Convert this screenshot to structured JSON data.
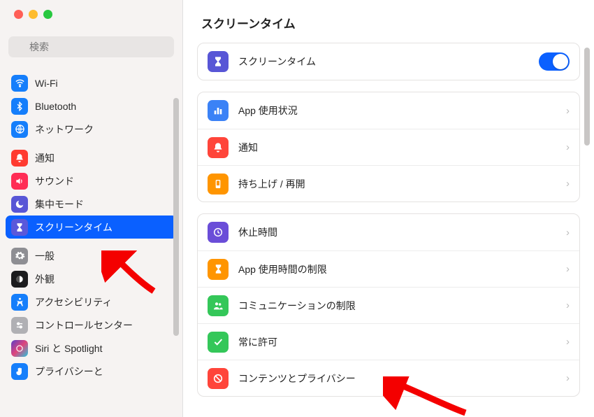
{
  "search": {
    "placeholder": "検索"
  },
  "sidebar": {
    "groups": [
      {
        "items": [
          {
            "name": "wifi",
            "label": "Wi-Fi"
          },
          {
            "name": "bluetooth",
            "label": "Bluetooth"
          },
          {
            "name": "network",
            "label": "ネットワーク"
          }
        ]
      },
      {
        "items": [
          {
            "name": "notifications",
            "label": "通知"
          },
          {
            "name": "sound",
            "label": "サウンド"
          },
          {
            "name": "focus",
            "label": "集中モード"
          },
          {
            "name": "screentime",
            "label": "スクリーンタイム",
            "selected": true
          }
        ]
      },
      {
        "items": [
          {
            "name": "general",
            "label": "一般"
          },
          {
            "name": "appearance",
            "label": "外観"
          },
          {
            "name": "accessibility",
            "label": "アクセシビリティ"
          },
          {
            "name": "controlcenter",
            "label": "コントロールセンター"
          },
          {
            "name": "siri",
            "label": "Siri と Spotlight"
          },
          {
            "name": "privacy",
            "label": "プライバシーと"
          }
        ]
      }
    ]
  },
  "main": {
    "title": "スクリーンタイム",
    "screentime_row": {
      "label": "スクリーンタイム",
      "on": true
    },
    "panels": [
      {
        "rows": [
          {
            "name": "app-usage",
            "label": "App 使用状況",
            "icon": "chart",
            "bg": "bg-bluesoft"
          },
          {
            "name": "notifications-report",
            "label": "通知",
            "icon": "bell",
            "bg": "bg-redsoft"
          },
          {
            "name": "wake",
            "label": "持ち上げ / 再開",
            "icon": "hand",
            "bg": "bg-orange"
          }
        ]
      },
      {
        "rows": [
          {
            "name": "downtime",
            "label": "休止時間",
            "icon": "clock",
            "bg": "bg-purple2"
          },
          {
            "name": "app-limits",
            "label": "App 使用時間の制限",
            "icon": "hourglass",
            "bg": "bg-orange"
          },
          {
            "name": "communication-limits",
            "label": "コミュニケーションの制限",
            "icon": "people",
            "bg": "bg-green"
          },
          {
            "name": "always-allowed",
            "label": "常に許可",
            "icon": "check",
            "bg": "bg-green"
          },
          {
            "name": "content-privacy",
            "label": "コンテンツとプライバシー",
            "icon": "nosign",
            "bg": "bg-redsoft"
          }
        ]
      }
    ]
  }
}
